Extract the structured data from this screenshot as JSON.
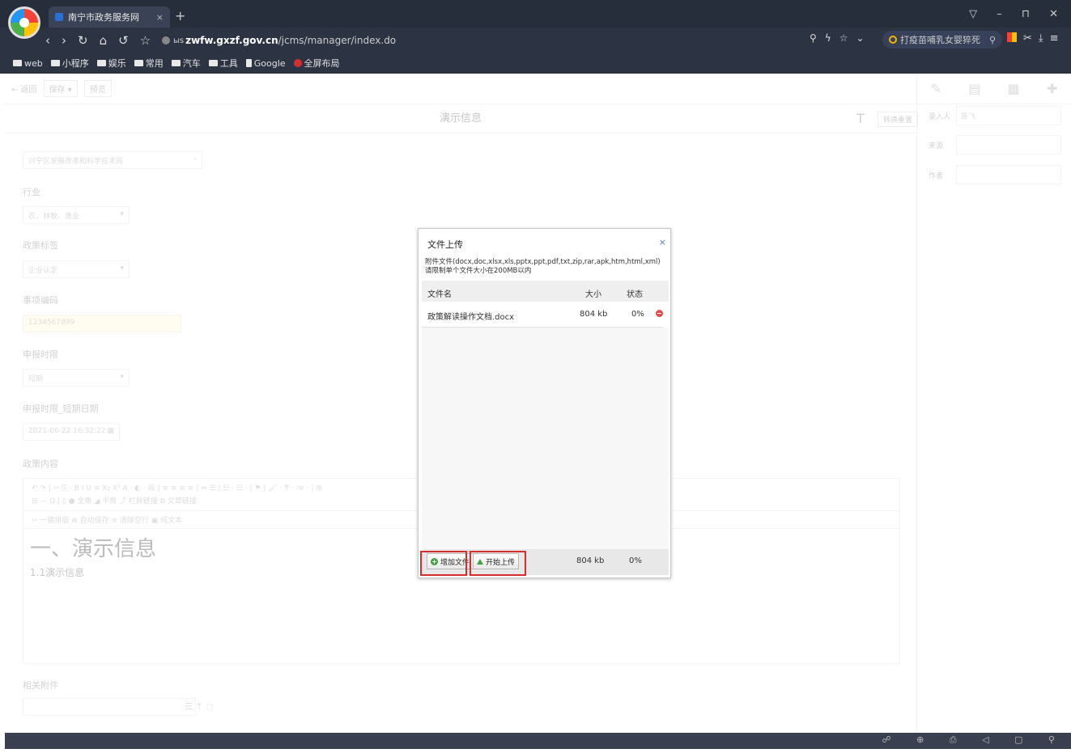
{
  "browser": {
    "tab_title": "南宁市政务服务网",
    "tab_close": "×",
    "new_tab": "+",
    "window_controls": "▽ – ⊓ ✕",
    "url_host": "zwfw.gxzf.gov.cn",
    "url_path": "/jcms/manager/index.do",
    "url_prefix": "ыs",
    "search_text": "打疫苗哺乳女婴猝死",
    "bookmarks": [
      "web",
      "小程序",
      "娱乐",
      "常用",
      "汽车",
      "工具",
      "Google",
      "全屏布局"
    ]
  },
  "app": {
    "toolbar": {
      "back": "← 返回",
      "save": "保存",
      "preview": "预览"
    },
    "doc_title": "演示信息",
    "reset_label": "转换重置",
    "form": {
      "dept_value": "兴宁区发展改革和科学技术局",
      "industry_label": "行业",
      "industry_value": "农、林牧、渔业",
      "policy_tag_label": "政策标签",
      "policy_tag_value": "企业认定",
      "item_code_label": "事项编码",
      "item_code_value": "1234567899",
      "deadline_label": "申报时限",
      "deadline_value": "短期",
      "deadline_date_label": "申报时限_短期日期",
      "deadline_date_value": "2021-06-22 16:32:22",
      "content_label": "政策内容"
    },
    "editor": {
      "tools_row1": "↶ ↷ | ✂ ⎘ · B I U ≡ X₂ X² A · ◐ · 段 | ≡ ≡ ≡ ≡ | ⇔ ☰ | ☷ · ☷ · | ⚑ | 🖌 · ₸ · ⁝≡ · | ⊞",
      "tools_row2": "⊟ — Ω | ▯ ● 全角 ◢ 半角 ⤴ 栏目链接 ⧉ 文章链接",
      "tools_row3": "✂ 一键排版  ⊕ 自动保存  ≡ 清除空行  ▣ 纯文本",
      "heading": "一、演示信息",
      "paragraph": "1.1演示信息"
    },
    "attachment_label": "相关附件",
    "right_panel": {
      "entered_by_label": "录入人",
      "entered_by_value": "陈飞",
      "source_label": "来源",
      "author_label": "作者"
    }
  },
  "modal": {
    "title": "文件上传",
    "close": "×",
    "hint_line1": "附件文件(docx,doc,xlsx,xls,pptx,ppt,pdf,txt,zip,rar,apk,htm,html,xml)",
    "hint_line2": "请限制单个文件大小在200MB以内",
    "columns": {
      "name": "文件名",
      "size": "大小",
      "status": "状态"
    },
    "files": [
      {
        "name": "政策解读操作文档.docx",
        "size": "804 kb",
        "progress": "0%"
      }
    ],
    "add_button": "增加文件",
    "start_button": "开始上传",
    "total_size": "804 kb",
    "total_progress": "0%",
    "highlight_color": "#d62d2d"
  }
}
